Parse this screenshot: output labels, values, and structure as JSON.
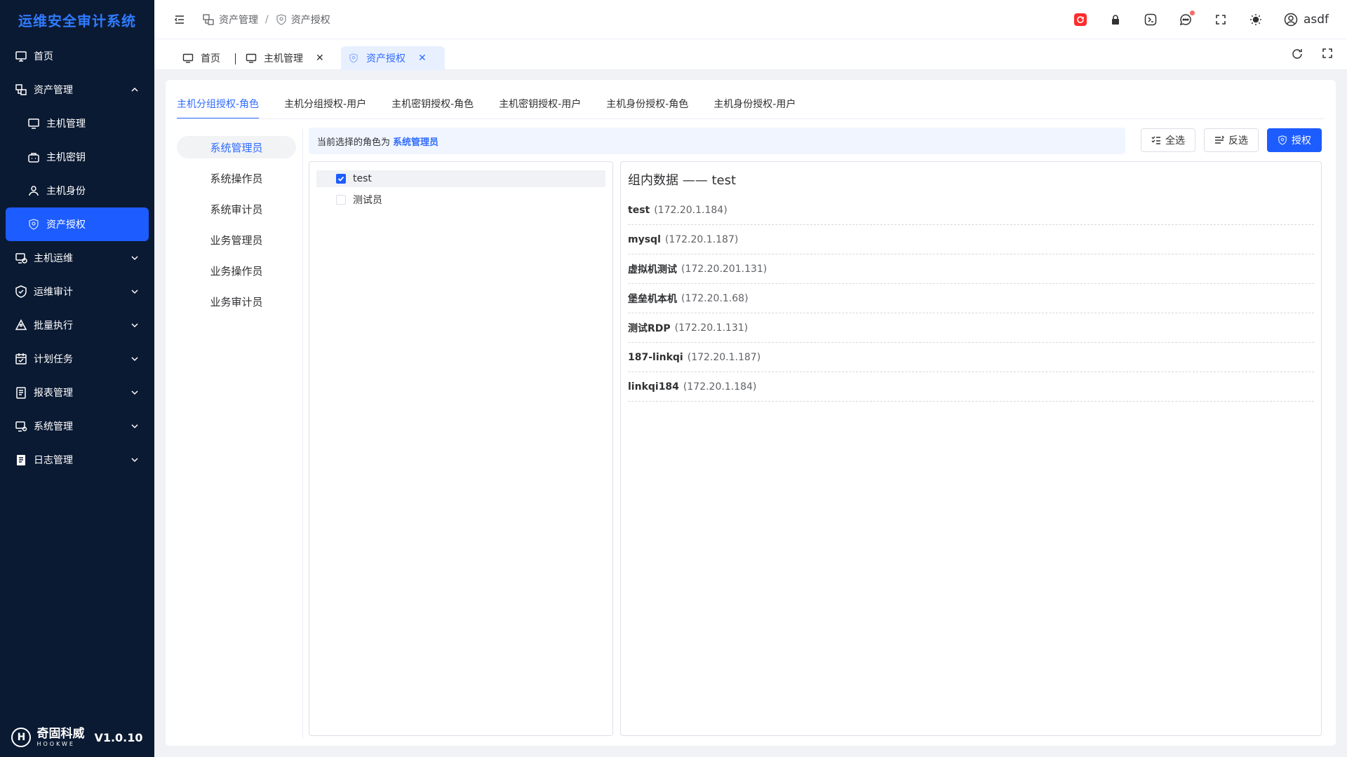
{
  "app": {
    "title": "运维安全审计系统",
    "version": "V1.0.10",
    "vendor_cn": "奇固科威",
    "vendor_en": "HOOKWE"
  },
  "sidebar": {
    "items": [
      {
        "label": "首页",
        "icon": "monitor-home-icon"
      },
      {
        "label": "资产管理",
        "icon": "asset-icon",
        "expanded": true,
        "children": [
          {
            "label": "主机管理",
            "icon": "host-icon"
          },
          {
            "label": "主机密钥",
            "icon": "key-icon"
          },
          {
            "label": "主机身份",
            "icon": "user-icon"
          },
          {
            "label": "资产授权",
            "icon": "shield-icon",
            "active": true
          }
        ]
      },
      {
        "label": "主机运维",
        "icon": "ops-icon"
      },
      {
        "label": "运维审计",
        "icon": "audit-icon"
      },
      {
        "label": "批量执行",
        "icon": "batch-icon"
      },
      {
        "label": "计划任务",
        "icon": "calendar-icon"
      },
      {
        "label": "报表管理",
        "icon": "report-icon"
      },
      {
        "label": "系统管理",
        "icon": "system-icon"
      },
      {
        "label": "日志管理",
        "icon": "log-icon"
      }
    ]
  },
  "header": {
    "breadcrumb": [
      "资产管理",
      "资产授权"
    ],
    "username": "asdf"
  },
  "tabs": [
    {
      "label": "首页"
    },
    {
      "label": "主机管理",
      "closable": true
    },
    {
      "label": "资产授权",
      "closable": true,
      "active": true
    }
  ],
  "subtabs": [
    "主机分组授权-角色",
    "主机分组授权-用户",
    "主机密钥授权-角色",
    "主机密钥授权-用户",
    "主机身份授权-角色",
    "主机身份授权-用户"
  ],
  "roles": [
    "系统管理员",
    "系统操作员",
    "系统审计员",
    "业务管理员",
    "业务操作员",
    "业务审计员"
  ],
  "info": {
    "prefix": "当前选择的角色为",
    "role": "系统管理员"
  },
  "buttons": {
    "select_all": "全选",
    "invert": "反选",
    "authorize": "授权"
  },
  "groups": [
    {
      "label": "test",
      "checked": true
    },
    {
      "label": "测试员",
      "checked": false
    }
  ],
  "data_panel": {
    "title": "组内数据 —— test",
    "hosts": [
      {
        "name": "test",
        "ip": "(172.20.1.184)"
      },
      {
        "name": "mysql",
        "ip": "(172.20.1.187)"
      },
      {
        "name": "虚拟机测试",
        "ip": "(172.20.201.131)"
      },
      {
        "name": "堡垒机本机",
        "ip": "(172.20.1.68)"
      },
      {
        "name": "测试RDP",
        "ip": "(172.20.1.131)"
      },
      {
        "name": "187-linkqi",
        "ip": "(172.20.1.187)"
      },
      {
        "name": "linkqi184",
        "ip": "(172.20.1.184)"
      }
    ]
  },
  "colors": {
    "primary": "#1d5cff",
    "sidebar_bg": "#0b1a33",
    "brand": "#2f7bff"
  }
}
